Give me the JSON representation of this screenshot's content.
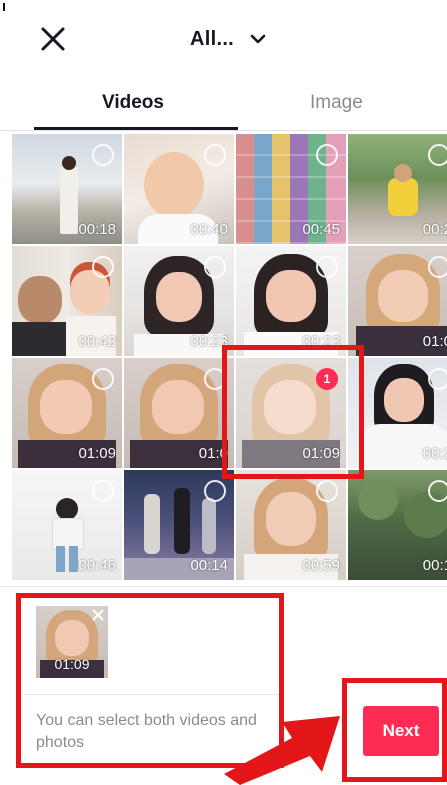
{
  "header": {
    "album_title": "All...",
    "close_icon": "close-icon",
    "chevron_icon": "chevron-down-icon"
  },
  "tabs": [
    {
      "label": "Videos",
      "active": true
    },
    {
      "label": "Image",
      "active": false
    }
  ],
  "grid": {
    "items": [
      {
        "duration": "00:18"
      },
      {
        "duration": "00:40"
      },
      {
        "duration": "00:45"
      },
      {
        "duration": "00:2"
      },
      {
        "duration": "00:42"
      },
      {
        "duration": "00:23"
      },
      {
        "duration": "00:23"
      },
      {
        "duration": "01:0"
      },
      {
        "duration": "01:09"
      },
      {
        "duration": "01:0"
      },
      {
        "duration": "01:09",
        "selected_index": "1"
      },
      {
        "duration": "00:2"
      },
      {
        "duration": "00:46"
      },
      {
        "duration": "00:14"
      },
      {
        "duration": "00:59"
      },
      {
        "duration": "00:1"
      }
    ]
  },
  "tray": {
    "selected_duration": "01:09",
    "hint": "You can select both videos and photos",
    "next_label": "Next"
  },
  "colors": {
    "accent": "#fe2c55",
    "annotation": "#e3161a"
  }
}
